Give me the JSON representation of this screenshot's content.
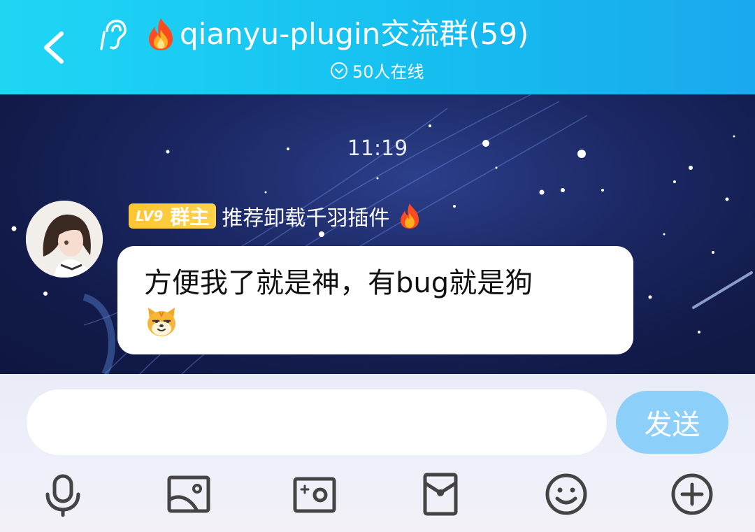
{
  "header": {
    "title": "qianyu-plugin交流群(59)",
    "online": "50人在线"
  },
  "chat": {
    "timestamp": "11:19",
    "message": {
      "level": "LV9",
      "role": "群主",
      "sender": "推荐卸载千羽插件",
      "text": "方便我了就是神，有bug就是狗"
    }
  },
  "composer": {
    "input_value": "",
    "send_label": "发送"
  },
  "toolbar": {
    "icons": [
      "microphone-icon",
      "image-icon",
      "camera-icon",
      "red-packet-icon",
      "emoji-icon",
      "plus-icon"
    ]
  },
  "colors": {
    "header": "#16bff0",
    "send_button": "#8ccff8",
    "badge": "#ffc533"
  }
}
